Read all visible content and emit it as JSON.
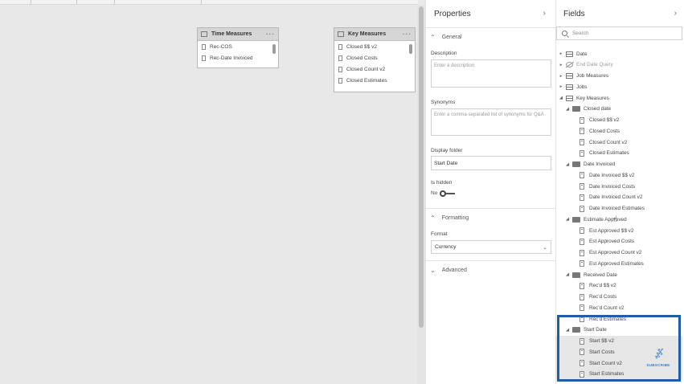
{
  "canvas": {
    "tables": [
      {
        "title": "Time Measures",
        "rows": [
          "Rec-COS",
          "Rec-Date Invoiced"
        ]
      },
      {
        "title": "Key Measures",
        "rows": [
          "Closed $$ v2",
          "Closed Costs",
          "Closed Count v2",
          "Closed Estimates"
        ]
      }
    ]
  },
  "properties": {
    "title": "Properties",
    "general": "General",
    "description_label": "Description",
    "description_placeholder": "Enter a description",
    "synonyms_label": "Synonyms",
    "synonyms_placeholder": "Enter a comma-separated list of synonyms for Q&A",
    "display_folder_label": "Display folder",
    "display_folder_value": "Start Date",
    "is_hidden_label": "Is hidden",
    "is_hidden_value": "No",
    "formatting": "Formatting",
    "format_label": "Format",
    "format_value": "Currency",
    "advanced": "Advanced"
  },
  "fields": {
    "title": "Fields",
    "search_placeholder": "Search",
    "items": [
      {
        "label": "Date",
        "kind": "table",
        "level": 0,
        "expanded": false
      },
      {
        "label": "End Date Query",
        "kind": "hidden-table",
        "level": 0,
        "expanded": false
      },
      {
        "label": "Job Measures",
        "kind": "table",
        "level": 0,
        "expanded": false
      },
      {
        "label": "Jobs",
        "kind": "table",
        "level": 0,
        "expanded": false
      },
      {
        "label": "Key Measures",
        "kind": "table",
        "level": 0,
        "expanded": true
      },
      {
        "label": "Closed date",
        "kind": "folder",
        "level": 1,
        "expanded": true
      },
      {
        "label": "Closed $$ v2",
        "kind": "measure",
        "level": 2
      },
      {
        "label": "Closed Costs",
        "kind": "measure",
        "level": 2
      },
      {
        "label": "Closed Count v2",
        "kind": "measure",
        "level": 2
      },
      {
        "label": "Closed Estimates",
        "kind": "measure",
        "level": 2
      },
      {
        "label": "Date Invoiced",
        "kind": "folder",
        "level": 1,
        "expanded": true
      },
      {
        "label": "Date Invoiced $$ v2",
        "kind": "measure",
        "level": 2
      },
      {
        "label": "Date Invoiced Costs",
        "kind": "measure",
        "level": 2
      },
      {
        "label": "Date Invoiced Count v2",
        "kind": "measure",
        "level": 2
      },
      {
        "label": "Date Invoiced Estimates",
        "kind": "measure",
        "level": 2
      },
      {
        "label": "Estimate Approved",
        "kind": "folder",
        "level": 1,
        "expanded": true
      },
      {
        "label": "Est Approved $$ v2",
        "kind": "measure",
        "level": 2
      },
      {
        "label": "Est Approved Costs",
        "kind": "measure",
        "level": 2
      },
      {
        "label": "Est Approved Count v2",
        "kind": "measure",
        "level": 2
      },
      {
        "label": "Est Approved Estimates",
        "kind": "measure",
        "level": 2
      },
      {
        "label": "Received Date",
        "kind": "folder",
        "level": 1,
        "expanded": true
      },
      {
        "label": "Rec'd $$ v2",
        "kind": "measure",
        "level": 2
      },
      {
        "label": "Rec'd Costs",
        "kind": "measure",
        "level": 2
      },
      {
        "label": "Rec'd Count v2",
        "kind": "measure",
        "level": 2
      },
      {
        "label": "Rec'd Estimates",
        "kind": "measure",
        "level": 2
      },
      {
        "label": "Start Date",
        "kind": "folder",
        "level": 1,
        "expanded": true
      },
      {
        "label": "Start $$ v2",
        "kind": "measure",
        "level": 2,
        "selected": true
      },
      {
        "label": "Start Costs",
        "kind": "measure",
        "level": 2,
        "selected": true
      },
      {
        "label": "Start Count v2",
        "kind": "measure",
        "level": 2,
        "selected": true
      },
      {
        "label": "Start Estimates",
        "kind": "measure",
        "level": 2,
        "selected": true
      }
    ]
  },
  "overlay": {
    "subscribe_text": "SUBSCRIBE",
    "highlight_color": "#1c5fa8"
  }
}
